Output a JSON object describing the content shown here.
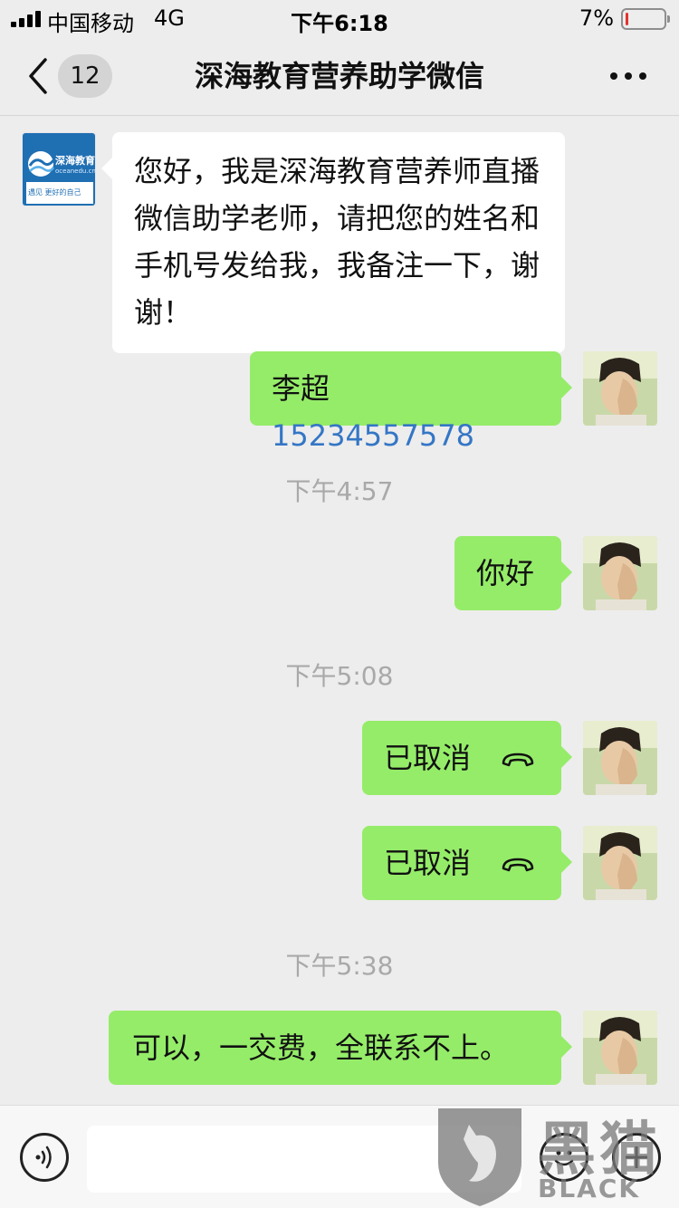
{
  "status_bar": {
    "carrier": "中国移动",
    "network": "4G",
    "time": "下午6:18",
    "battery_percent": "7%",
    "battery_level": 0.07,
    "battery_color": "#e3342f"
  },
  "nav": {
    "back_icon": "chevron-left-icon",
    "unread_count": "12",
    "title": "深海教育营养助学微信",
    "more_icon": "more-dots-icon"
  },
  "contact_avatar": {
    "brand": "深海教育",
    "domain": "oceanedu.cn",
    "slogan": "遇见 更好的自己"
  },
  "messages": [
    {
      "side": "left",
      "text": "您好，我是深海教育营养师直播微信助学老师，请把您的姓名和手机号发给我，我备注一下，谢谢！"
    },
    {
      "side": "right",
      "name": "李超",
      "phone": "15234557578"
    },
    {
      "timestamp": "下午4:57"
    },
    {
      "side": "right",
      "text": "你好"
    },
    {
      "timestamp": "下午5:08"
    },
    {
      "side": "right",
      "text": "已取消",
      "icon": "phone-hangup-icon"
    },
    {
      "side": "right",
      "text": "已取消",
      "icon": "phone-hangup-icon"
    },
    {
      "timestamp": "下午5:38"
    },
    {
      "side": "right",
      "text": "可以，一交费，全联系不上。"
    }
  ],
  "colors": {
    "background": "#ededed",
    "sent_bubble": "#95ec69",
    "received_bubble": "#ffffff",
    "link": "#3476c5",
    "timestamp": "#a9a9a9"
  },
  "input_bar": {
    "voice_icon": "voice-icon",
    "emoji_icon": "emoji-icon",
    "plus_icon": "plus-icon",
    "input_value": ""
  },
  "watermark": {
    "cn": "黑猫",
    "en": "BLACK CAT"
  }
}
